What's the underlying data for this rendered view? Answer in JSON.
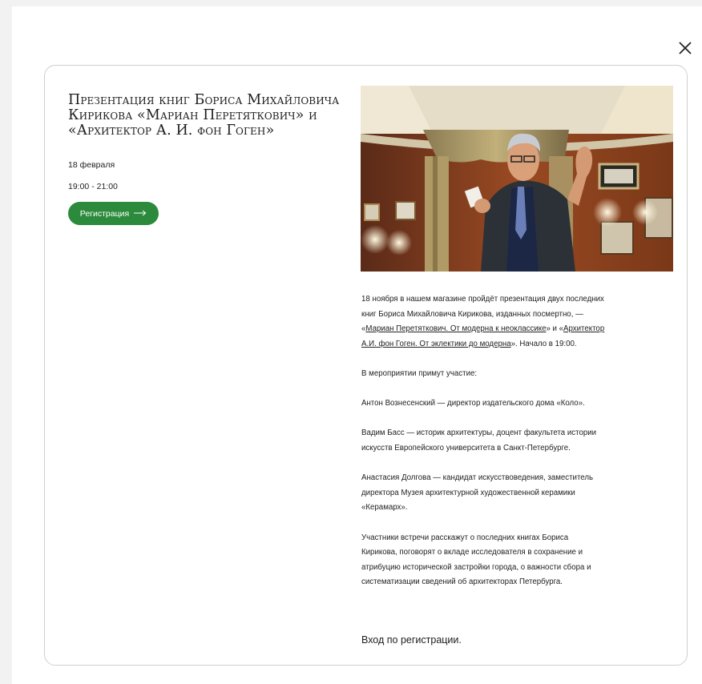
{
  "modal": {
    "close_icon": "close-icon"
  },
  "event": {
    "title": "Презентация книг Бориса Михайловича Кирикова «Мариан Перетяткович» и «Архитектор А. И. фон Гоген»",
    "date": "18 февраля",
    "time": "19:00 - 21:00",
    "register_label": "Регистрация",
    "register_icon": "arrow-right-icon",
    "accent_color": "#2b8a3b"
  },
  "photo": {
    "icon": "event-photo"
  },
  "description": {
    "p1_part1": "18 ноября в нашем магазине пройдёт презентация двух последних книг Бориса Михайловича Кирикова, изданных посмертно, —  «",
    "link1": "Мариан Перетяткович. От модерна к неоклассике",
    "p1_part2": "» и «",
    "link2": "Архитектор А.И. фон Гоген. От эклектики до модерна",
    "p1_part3": "». Начало в 19:00.",
    "p2": "В мероприятии примут участие:",
    "p3": "Антон Вознесенский — директор издательского дома «Коло».",
    "p4": "Вадим Басс — историк архитектуры, доцент факультета истории искусств Европейского университета в Санкт-Петербурге.",
    "p5": "Анастасия Долгова — кандидат искусствоведения, заместитель директора Музея архитектурной художественной керамики «Керамарх».",
    "p6": "Участники встречи расскажут о последних книгах Бориса Кирикова, поговорят о вкладе исследователя в сохранение и атрибуцию исторической застройки города, о важности сбора и систематизации сведений об архитекторах Петербурга.",
    "entry_note": "Вход по регистрации."
  }
}
